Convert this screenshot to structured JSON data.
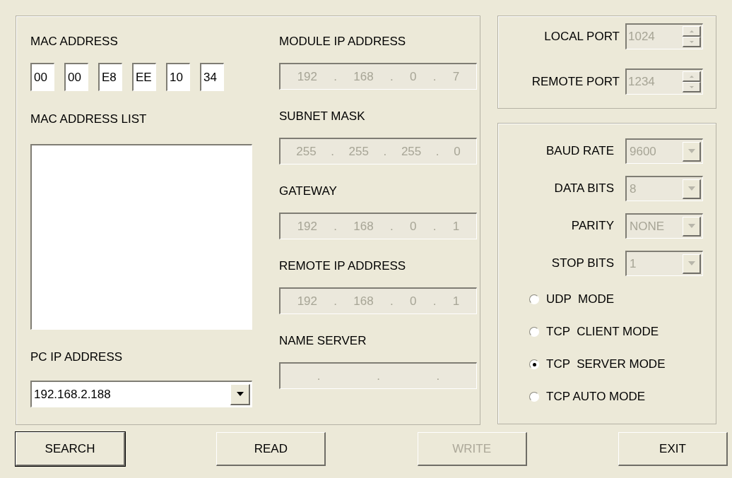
{
  "mac_address": {
    "label": "MAC ADDRESS",
    "octets": [
      "00",
      "00",
      "E8",
      "EE",
      "10",
      "34"
    ]
  },
  "mac_address_list": {
    "label": "MAC ADDRESS LIST"
  },
  "pc_ip_address": {
    "label": "PC IP ADDRESS",
    "value": "192.168.2.188"
  },
  "ip_fields": [
    {
      "label": "MODULE IP ADDRESS",
      "octets": [
        "192",
        "168",
        "0",
        "7"
      ],
      "dots": [
        ".",
        ".",
        "."
      ],
      "disabled": true
    },
    {
      "label": "SUBNET MASK",
      "octets": [
        "255",
        "255",
        "255",
        "0"
      ],
      "dots": [
        ".",
        ".",
        "."
      ],
      "disabled": true
    },
    {
      "label": "GATEWAY",
      "octets": [
        "192",
        "168",
        "0",
        "1"
      ],
      "dots": [
        ".",
        ".",
        "."
      ],
      "disabled": true
    },
    {
      "label": "REMOTE IP ADDRESS",
      "octets": [
        "192",
        "168",
        "0",
        "1"
      ],
      "dots": [
        ".",
        ".",
        "."
      ],
      "disabled": true
    },
    {
      "label": "NAME SERVER",
      "dots": [
        ".",
        ".",
        "."
      ],
      "disabled": true
    }
  ],
  "ports": [
    {
      "label": "LOCAL PORT",
      "value": "1024",
      "disabled": true
    },
    {
      "label": "REMOTE PORT",
      "value": "1234",
      "disabled": true
    }
  ],
  "serial": [
    {
      "label": "BAUD RATE",
      "value": "9600",
      "disabled": true
    },
    {
      "label": "DATA BITS",
      "value": "8",
      "disabled": true
    },
    {
      "label": "PARITY",
      "value": "NONE",
      "disabled": true
    },
    {
      "label": "STOP BITS",
      "value": "1",
      "disabled": true
    }
  ],
  "modes": [
    {
      "label": "UDP  MODE",
      "selected": false
    },
    {
      "label": "TCP  CLIENT MODE",
      "selected": false
    },
    {
      "label": "TCP  SERVER MODE",
      "selected": true
    },
    {
      "label": "TCP AUTO MODE",
      "selected": false
    }
  ],
  "buttons": [
    {
      "label": "SEARCH",
      "disabled": false,
      "default": true
    },
    {
      "label": "READ",
      "disabled": false,
      "default": false
    },
    {
      "label": "WRITE",
      "disabled": true,
      "default": false
    },
    {
      "label": "EXIT",
      "disabled": false,
      "default": false
    }
  ]
}
